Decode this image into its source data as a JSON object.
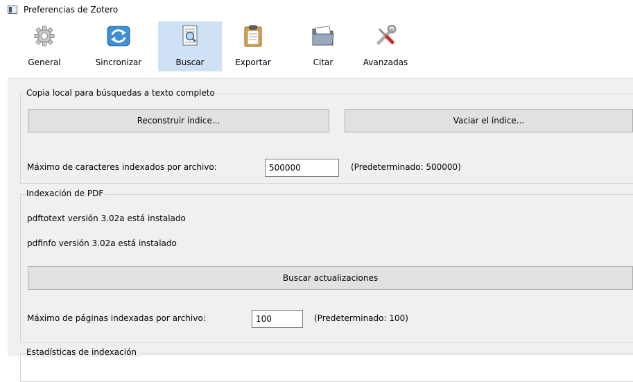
{
  "window": {
    "title": "Preferencias de Zotero"
  },
  "toolbar": {
    "tabs": [
      {
        "label": "General",
        "icon": "gear-icon"
      },
      {
        "label": "Sincronizar",
        "icon": "sync-icon"
      },
      {
        "label": "Buscar",
        "icon": "search-document-icon",
        "selected": true
      },
      {
        "label": "Exportar",
        "icon": "clipboard-icon"
      },
      {
        "label": "Citar",
        "icon": "folder-icon"
      },
      {
        "label": "Avanzadas",
        "icon": "tools-icon"
      }
    ]
  },
  "fulltext": {
    "legend": "Copia local para búsquedas a texto completo",
    "rebuild_label": "Reconstruir índice...",
    "clear_label": "Vaciar el índice...",
    "max_chars_label": "Máximo de caracteres indexados por archivo:",
    "max_chars_value": "500000",
    "max_chars_default": "(Predeterminado: 500000)"
  },
  "pdf": {
    "legend": "Indexación de PDF",
    "pdftotext_status": "pdftotext versión 3.02a está instalado",
    "pdfinfo_status": "pdfinfo versión 3.02a está instalado",
    "check_updates_label": "Buscar actualizaciones",
    "max_pages_label": "Máximo de páginas indexadas por archivo:",
    "max_pages_value": "100",
    "max_pages_default": "(Predeterminado: 100)"
  },
  "stats": {
    "legend": "Estadísticas de indexación"
  },
  "colors": {
    "selected_tab": "#cfe1f5",
    "panel_bg": "#f0f0f0",
    "button_bg": "#e1e1e1"
  }
}
